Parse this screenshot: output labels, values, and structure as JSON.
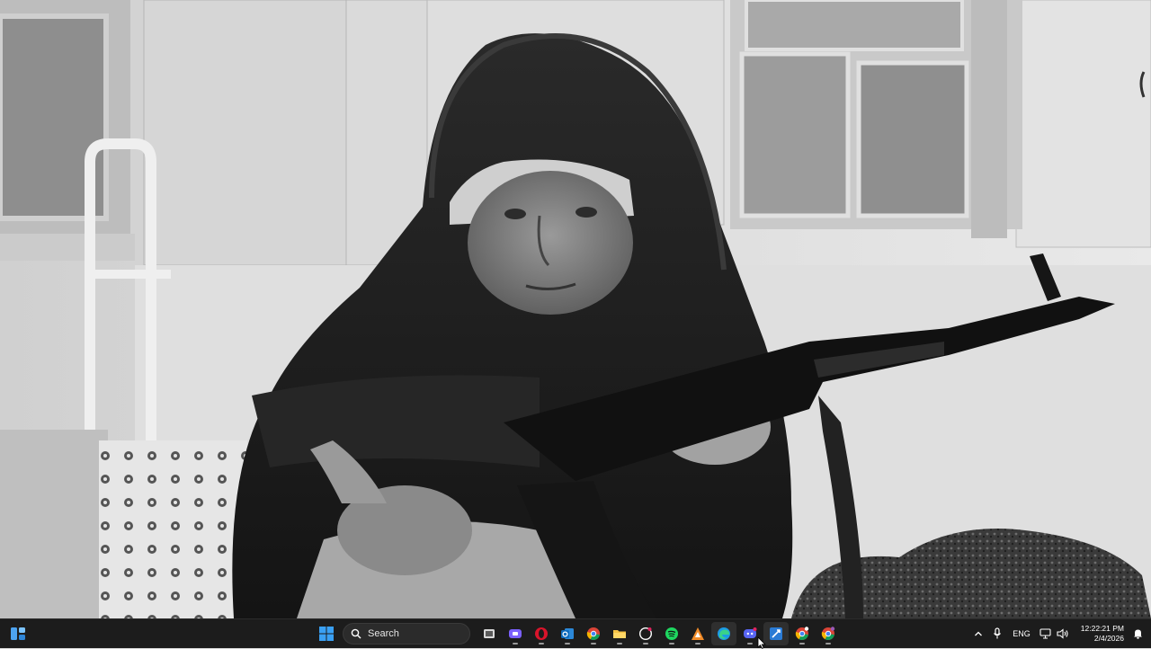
{
  "wallpaper": {
    "description_icon": "photo-wallpaper"
  },
  "taskbar": {
    "search_label": "Search",
    "language": "ENG",
    "time": "12:22:21 PM",
    "date": "2/4/2026",
    "apps": [
      {
        "name": "task-view",
        "icon": "task-view-icon"
      },
      {
        "name": "teams",
        "icon": "teams-icon"
      },
      {
        "name": "opera",
        "icon": "opera-icon"
      },
      {
        "name": "outlook",
        "icon": "outlook-icon"
      },
      {
        "name": "chrome",
        "icon": "chrome-icon"
      },
      {
        "name": "file-explorer",
        "icon": "folder-icon"
      },
      {
        "name": "github",
        "icon": "github-icon"
      },
      {
        "name": "spotify",
        "icon": "spotify-icon"
      },
      {
        "name": "vlc-like",
        "icon": "app-orange-icon"
      },
      {
        "name": "edge",
        "icon": "edge-icon"
      },
      {
        "name": "discord",
        "icon": "discord-icon"
      },
      {
        "name": "visual-studio",
        "icon": "vs-icon"
      },
      {
        "name": "chrome-profile",
        "icon": "chrome-icon"
      },
      {
        "name": "chrome-profile-2",
        "icon": "chrome-icon"
      }
    ],
    "colors": {
      "bar": "#1c1c1c",
      "accent": "#5fb2f2"
    }
  }
}
